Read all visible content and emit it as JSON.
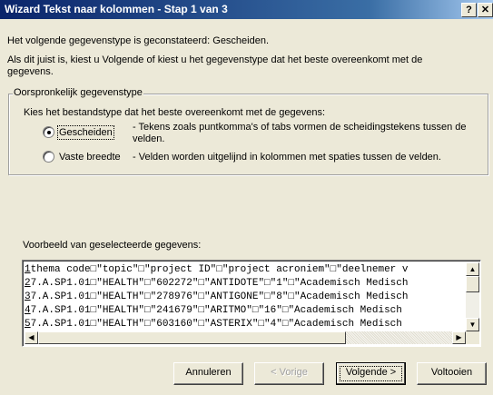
{
  "window": {
    "title": "Wizard Tekst naar kolommen - Stap 1 van 3",
    "help_glyph": "?",
    "close_glyph": "✕"
  },
  "intro": {
    "detected": "Het volgende gegevenstype is geconstateerd: Gescheiden.",
    "advice_line1": "Als dit juist is, kiest u Volgende of kiest u het gegevenstype dat het beste overeenkomt met de",
    "advice_line2": "gegevens."
  },
  "group": {
    "label": "Oorspronkelijk gegevenstype",
    "prompt": "Kies het bestandstype dat het beste overeenkomt met de gegevens:",
    "options": [
      {
        "label": "Gescheiden",
        "description": "- Tekens zoals puntkomma's of tabs vormen de scheidingstekens tussen de velden.",
        "selected": true
      },
      {
        "label": "Vaste breedte",
        "description": "- Velden worden uitgelijnd in kolommen met spaties tussen de velden.",
        "selected": false
      }
    ]
  },
  "preview": {
    "label": "Voorbeeld van geselecteerde gegevens:",
    "rows": [
      {
        "num": "1",
        "text": "thema code□\"topic\"□\"project ID\"□\"project acroniem\"□\"deelnemer v"
      },
      {
        "num": "2",
        "text": "7.A.SP1.01□\"HEALTH\"□\"602272\"□\"ANTIDOTE\"□\"1\"□\"Academisch Medisch"
      },
      {
        "num": "3",
        "text": "7.A.SP1.01□\"HEALTH\"□\"278976\"□\"ANTIGONE\"□\"8\"□\"Academisch Medisch"
      },
      {
        "num": "4",
        "text": "7.A.SP1.01□\"HEALTH\"□\"241679\"□\"ARITMO\"□\"16\"□\"Academisch Medisch"
      },
      {
        "num": "5",
        "text": "7.A.SP1.01□\"HEALTH\"□\"603160\"□\"ASTERIX\"□\"4\"□\"Academisch Medisch"
      }
    ]
  },
  "buttons": {
    "cancel": "Annuleren",
    "back": "< Vorige",
    "next": "Volgende >",
    "finish": "Voltooien"
  },
  "icons": {
    "up": "up-arrow-icon",
    "down": "down-arrow-icon",
    "left": "left-arrow-icon",
    "right": "right-arrow-icon"
  },
  "colors": {
    "titlebar_start": "#0a246a",
    "titlebar_end": "#a6caf0",
    "face": "#ece9d8"
  }
}
